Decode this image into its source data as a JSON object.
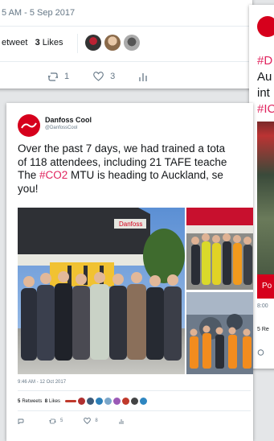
{
  "top_tweet": {
    "timestamp": "5 AM - 5 Sep 2017",
    "retweet_label": "etweet",
    "likes_count": "3",
    "likes_label": "Likes",
    "reply_count": "1",
    "like_count": "3"
  },
  "right_tweet": {
    "text_lines": [
      "#D",
      "Au",
      "int",
      "#IC"
    ],
    "button_label": "Po",
    "time": "8:00",
    "stats": "5 Re"
  },
  "main_tweet": {
    "display_name": "Danfoss Cool",
    "handle": "@DanfossCool",
    "text_part1": "Over the past 7 days, we had trained a tota\nof 118 attendees, including 21 TAFE teache\nThe ",
    "hashtag": "#CO2",
    "text_part2": " MTU is heading to Auckland, se\nyou!",
    "photo_sign": "Danfoss",
    "timestamp": "9:46 AM - 12 Oct 2017",
    "retweets_count": "5",
    "retweets_label": "Retweets",
    "likes_count": "8",
    "likes_label": "Likes",
    "reply_count": "5",
    "like_count": "8"
  },
  "colors": {
    "brand_red": "#d6001c",
    "hashtag": "#e0245e",
    "muted": "#657786"
  }
}
